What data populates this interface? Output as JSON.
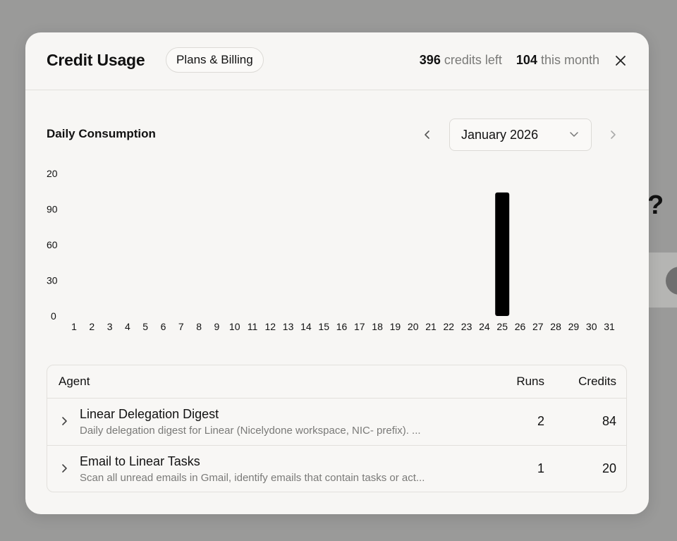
{
  "header": {
    "title": "Credit Usage",
    "plans_button": "Plans & Billing",
    "credits_left_value": "396",
    "credits_left_label": "credits left",
    "this_month_value": "104",
    "this_month_label": "this month"
  },
  "section": {
    "title": "Daily Consumption"
  },
  "month_picker": {
    "selected": "January 2026"
  },
  "colors": {
    "bar": "#000000",
    "modal_bg": "#f7f6f4",
    "overlay": "#9a9a99"
  },
  "chart_data": {
    "type": "bar",
    "categories": [
      "1",
      "2",
      "3",
      "4",
      "5",
      "6",
      "7",
      "8",
      "9",
      "10",
      "11",
      "12",
      "13",
      "14",
      "15",
      "16",
      "17",
      "18",
      "19",
      "20",
      "21",
      "22",
      "23",
      "24",
      "25",
      "26",
      "27",
      "28",
      "29",
      "30",
      "31"
    ],
    "values": [
      0,
      0,
      0,
      0,
      0,
      0,
      0,
      0,
      0,
      0,
      0,
      0,
      0,
      0,
      0,
      0,
      0,
      0,
      0,
      0,
      0,
      0,
      0,
      0,
      104,
      0,
      0,
      0,
      0,
      0,
      0
    ],
    "ytick_labels": [
      "20",
      "90",
      "60",
      "30",
      "0"
    ],
    "ylim": [
      0,
      120
    ],
    "grid": false,
    "legend": "none"
  },
  "table": {
    "headers": {
      "agent": "Agent",
      "runs": "Runs",
      "credits": "Credits"
    },
    "rows": [
      {
        "name": "Linear Delegation Digest",
        "description": "Daily delegation digest for Linear (Nicelydone workspace, NIC- prefix). ...",
        "runs": "2",
        "credits": "84"
      },
      {
        "name": "Email to Linear Tasks",
        "description": "Scan all unread emails in Gmail, identify emails that contain tasks or act...",
        "runs": "1",
        "credits": "20"
      }
    ]
  },
  "background": {
    "partial_text": "?"
  }
}
